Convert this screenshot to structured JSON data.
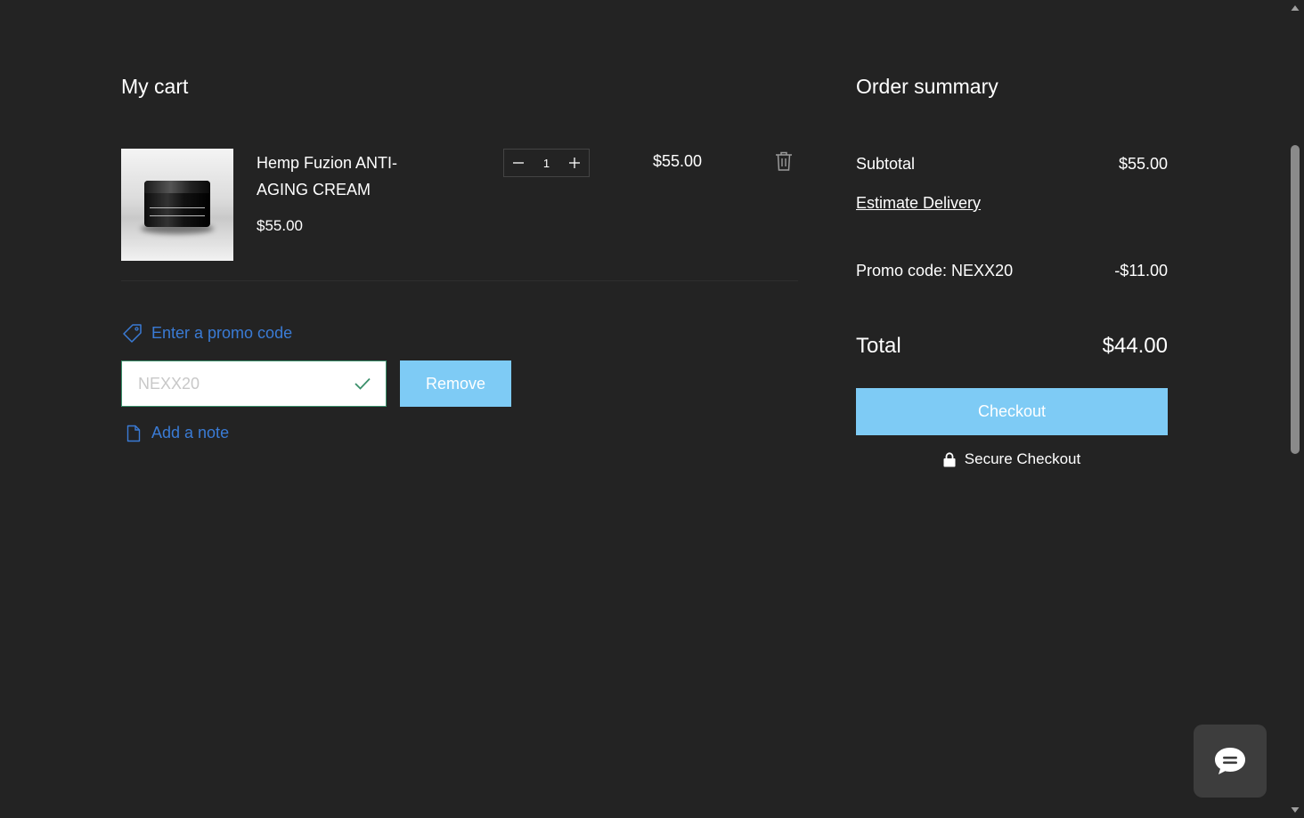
{
  "cart": {
    "title": "My cart",
    "item": {
      "name": "Hemp Fuzion ANTI-AGING CREAM",
      "unit_price": "$55.00",
      "quantity": "1",
      "line_total": "$55.00",
      "image_icon": "product-jar-image"
    },
    "promo": {
      "link_label": "Enter a promo code",
      "input_value": "NEXX20",
      "input_placeholder": "Enter a promo code",
      "remove_label": "Remove"
    },
    "note": {
      "link_label": "Add a note"
    }
  },
  "summary": {
    "title": "Order summary",
    "subtotal_label": "Subtotal",
    "subtotal_value": "$55.00",
    "estimate_delivery_label": "Estimate Delivery",
    "promo_label": "Promo code: NEXX20",
    "promo_value": "-$11.00",
    "total_label": "Total",
    "total_value": "$44.00",
    "checkout_label": "Checkout",
    "secure_label": "Secure Checkout"
  },
  "colors": {
    "background": "#232323",
    "link_blue": "#3a7bd5",
    "button_blue": "#7ecbf5",
    "valid_green": "#3a8f6a"
  }
}
